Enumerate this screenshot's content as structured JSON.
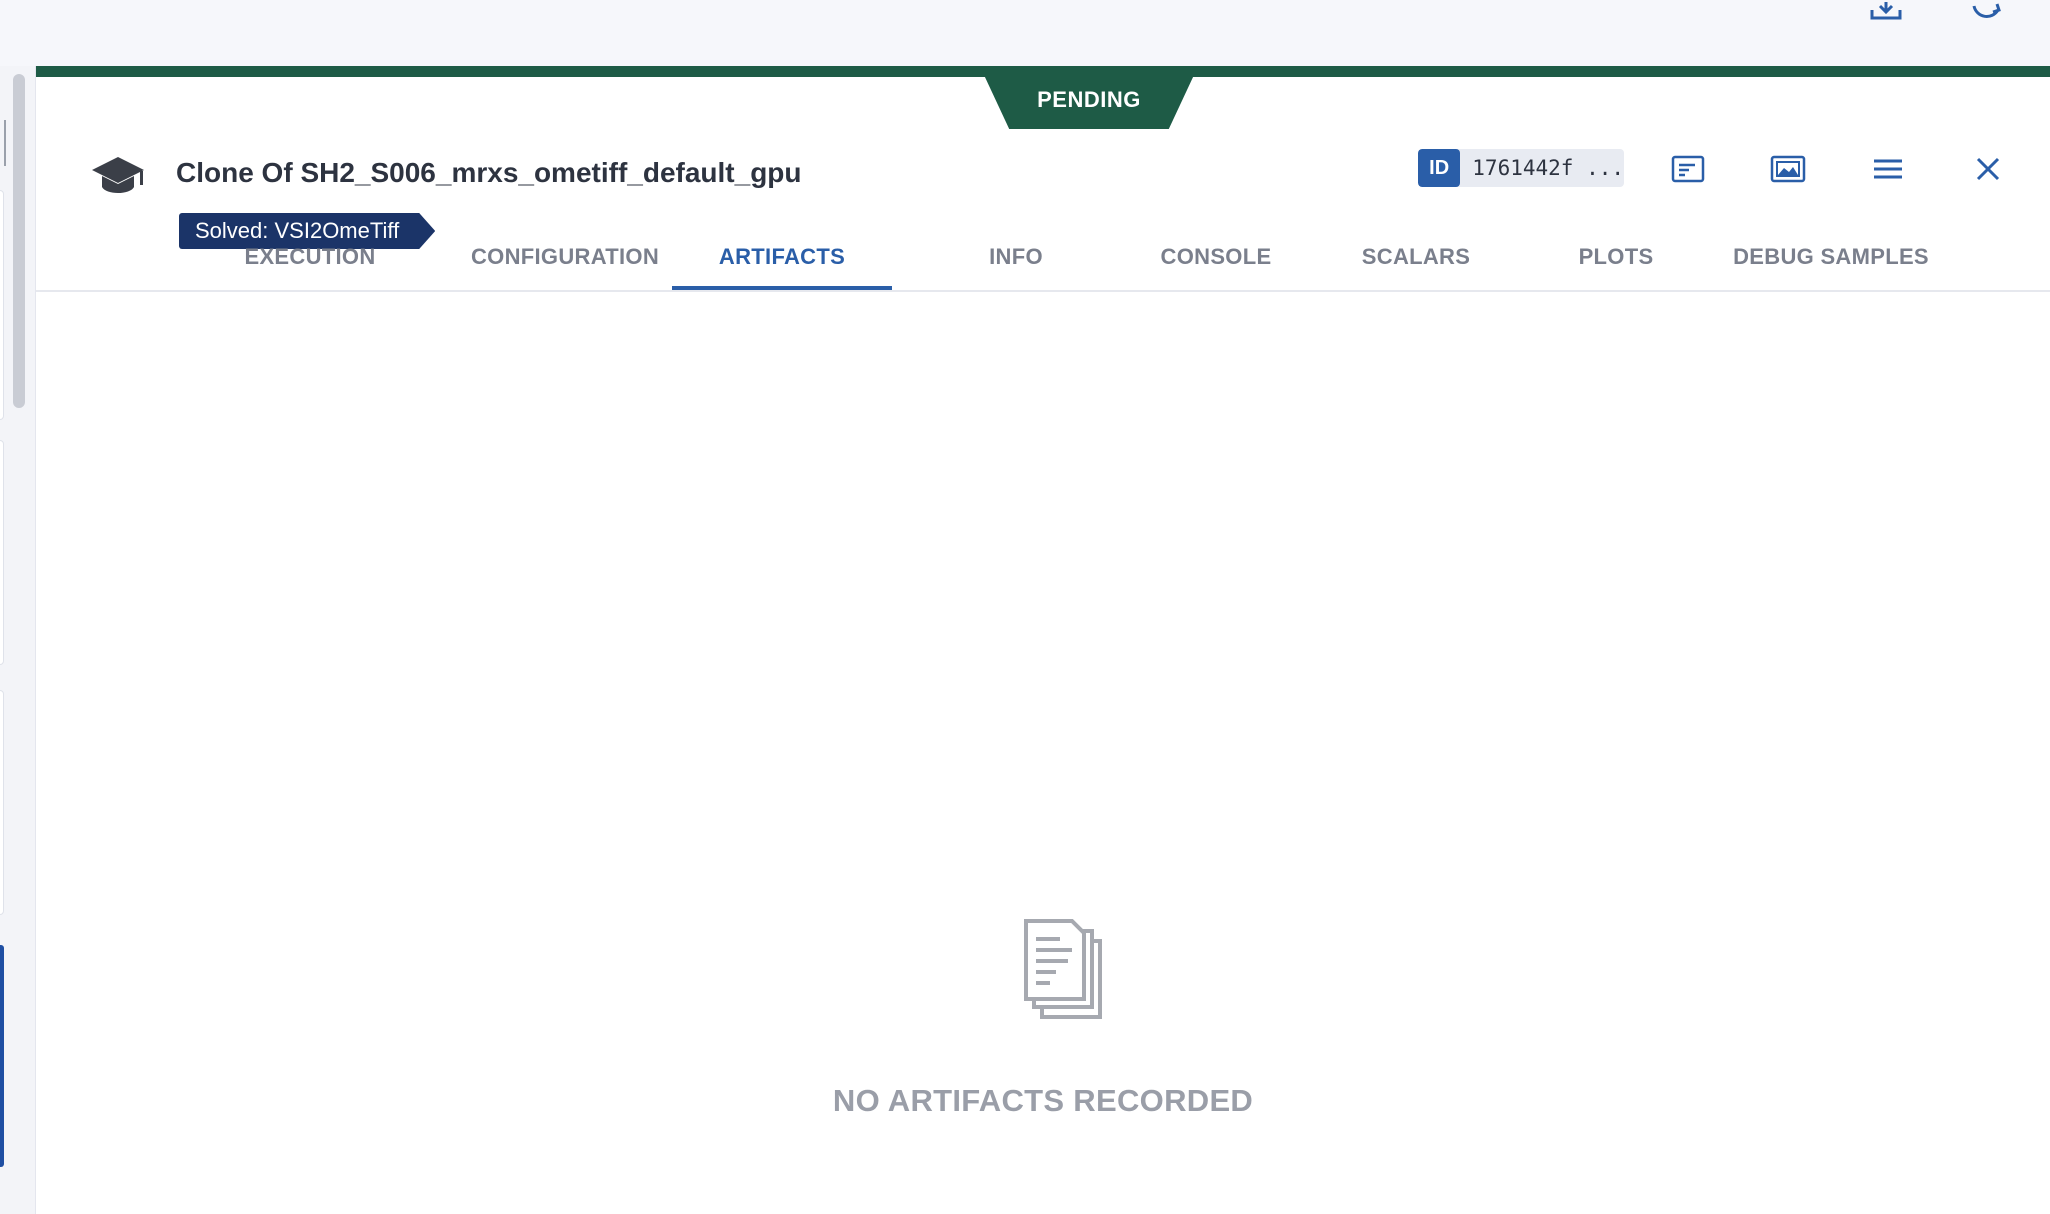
{
  "status": "PENDING",
  "task": {
    "title": "Clone Of SH2_S006_mrxs_ometiff_default_gpu",
    "tag": "Solved: VSI2OmeTiff",
    "id_label": "ID",
    "id_value": "1761442f ..."
  },
  "header_icons": [
    "task-type-icon",
    "console-icon",
    "image-icon",
    "menu-icon",
    "close-icon"
  ],
  "top_icons": [
    "download-icon",
    "refresh-icon"
  ],
  "tabs": [
    {
      "label": "EXECUTION",
      "active": false
    },
    {
      "label": "CONFIGURATION",
      "active": false
    },
    {
      "label": "ARTIFACTS",
      "active": true
    },
    {
      "label": "INFO",
      "active": false
    },
    {
      "label": "CONSOLE",
      "active": false
    },
    {
      "label": "SCALARS",
      "active": false
    },
    {
      "label": "PLOTS",
      "active": false
    },
    {
      "label": "DEBUG SAMPLES",
      "active": false
    }
  ],
  "empty_state": {
    "icon": "documents-icon",
    "message": "NO ARTIFACTS RECORDED"
  },
  "colors": {
    "status_green": "#1e5b46",
    "accent_blue": "#2a5ea8",
    "tag_navy": "#1b3468"
  }
}
